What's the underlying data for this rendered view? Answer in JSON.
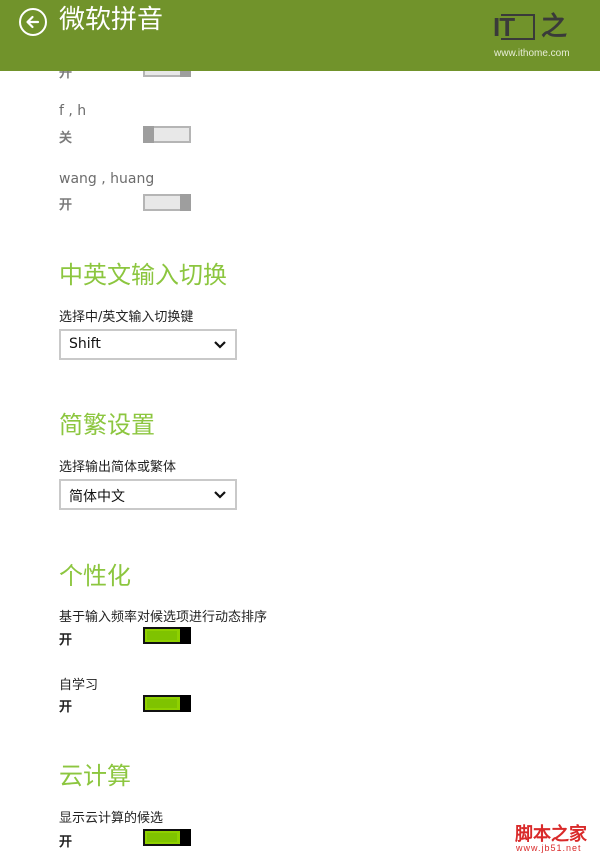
{
  "header": {
    "title": "微软拼音",
    "back_icon": "back-arrow-icon",
    "bg_color": "#71932b"
  },
  "watermark_top": {
    "logo_it": "IT",
    "logo_zhi": "之",
    "url": "www.ithome.com"
  },
  "fuzzy": {
    "partial_state": "开",
    "items": [
      {
        "label": "f , h",
        "state": "关"
      },
      {
        "label": "wang , huang",
        "state": "开"
      }
    ]
  },
  "lang_switch": {
    "title": "中英文输入切换",
    "label": "选择中/英文输入切换键",
    "value": "Shift"
  },
  "simp_trad": {
    "title": "简繁设置",
    "label": "选择输出简体或繁体",
    "value": "简体中文"
  },
  "personal": {
    "title": "个性化",
    "items": [
      {
        "label": "基于输入频率对候选项进行动态排序",
        "state": "开"
      },
      {
        "label": "自学习",
        "state": "开"
      }
    ]
  },
  "cloud": {
    "title": "云计算",
    "items": [
      {
        "label": "显示云计算的候选",
        "state": "开"
      }
    ]
  },
  "watermark_bottom": {
    "cn": "脚本之家",
    "url": "www.jb51.net"
  },
  "colors": {
    "accent": "#8cc63f",
    "toggle_on": "#7fc300"
  }
}
